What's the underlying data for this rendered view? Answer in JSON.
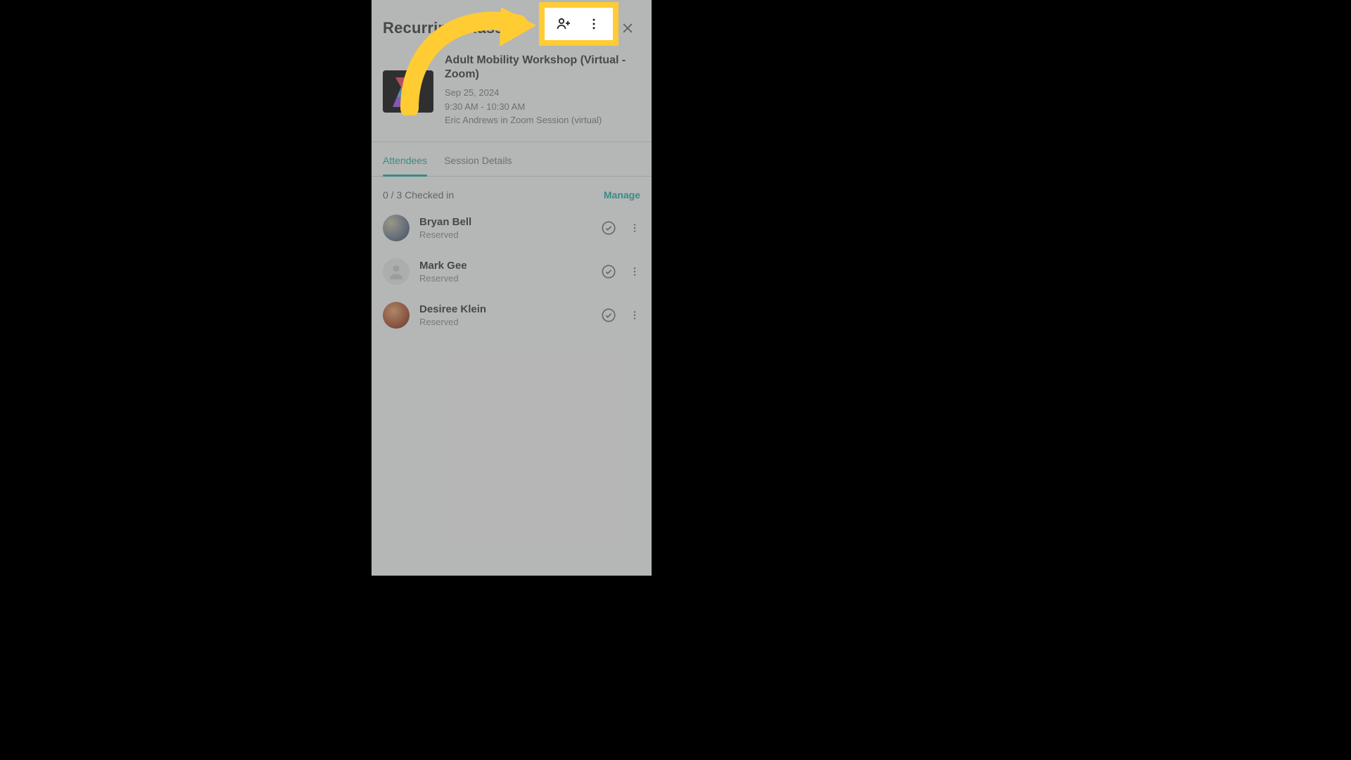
{
  "header": {
    "title": "Recurring Class"
  },
  "class": {
    "title": "Adult Mobility Workshop (Virtual - Zoom)",
    "date": "Sep 25, 2024",
    "time": "9:30 AM - 10:30 AM",
    "location": "Eric Andrews in Zoom Session (virtual)"
  },
  "tabs": {
    "attendees": "Attendees",
    "details": "Session Details"
  },
  "checkin": {
    "count": "0 / 3 Checked in",
    "manage": "Manage"
  },
  "attendees": [
    {
      "name": "Bryan Bell",
      "status": "Reserved"
    },
    {
      "name": "Mark Gee",
      "status": "Reserved"
    },
    {
      "name": "Desiree Klein",
      "status": "Reserved"
    }
  ],
  "colors": {
    "accent": "#2aa79b",
    "highlight": "#ffcc33"
  }
}
